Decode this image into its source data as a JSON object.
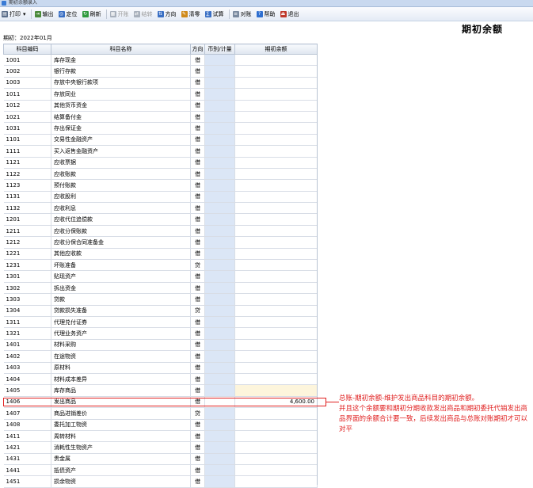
{
  "window": {
    "title": "期初余额录入"
  },
  "toolbar": [
    {
      "label": "打印",
      "icon": "printer-icon",
      "dropdown": true,
      "disabled": false,
      "color": "#5a6d8a"
    },
    {
      "label": "输出",
      "icon": "export-icon",
      "disabled": false,
      "color": "#4a8a3a"
    },
    {
      "label": "定位",
      "icon": "locate-icon",
      "disabled": false,
      "color": "#3a6fc4"
    },
    {
      "label": "刷新",
      "icon": "refresh-icon",
      "disabled": false,
      "color": "#2f9a3f"
    },
    {
      "label": "开账",
      "icon": "open-account-icon",
      "disabled": true,
      "color": "#a8b0bc"
    },
    {
      "label": "结转",
      "icon": "carry-over-icon",
      "disabled": true,
      "color": "#a8b0bc"
    },
    {
      "label": "方向",
      "icon": "direction-icon",
      "disabled": false,
      "color": "#3a6fc4"
    },
    {
      "label": "清零",
      "icon": "clear-icon",
      "disabled": false,
      "color": "#d08a1a"
    },
    {
      "label": "试算",
      "icon": "trial-balance-icon",
      "disabled": false,
      "color": "#3a6fc4"
    },
    {
      "label": "对账",
      "icon": "reconcile-icon",
      "disabled": false,
      "color": "#7a8aa0"
    },
    {
      "label": "帮助",
      "icon": "help-icon",
      "disabled": false,
      "color": "#2f6fd0"
    },
    {
      "label": "退出",
      "icon": "exit-icon",
      "disabled": false,
      "color": "#c0392b"
    }
  ],
  "page_title": "期初余额",
  "period_text": "期初：2022年01月",
  "columns": [
    "科目编码",
    "科目名称",
    "方向",
    "币别/计量",
    "期初余额"
  ],
  "rows": [
    {
      "code": "1001",
      "name": "库存现金",
      "dir": "借",
      "amount": ""
    },
    {
      "code": "1002",
      "name": "银行存款",
      "dir": "借",
      "amount": ""
    },
    {
      "code": "1003",
      "name": "存放中央银行款项",
      "dir": "借",
      "amount": ""
    },
    {
      "code": "1011",
      "name": "存放同业",
      "dir": "借",
      "amount": ""
    },
    {
      "code": "1012",
      "name": "其他货币资金",
      "dir": "借",
      "amount": ""
    },
    {
      "code": "1021",
      "name": "结算备付金",
      "dir": "借",
      "amount": ""
    },
    {
      "code": "1031",
      "name": "存出保证金",
      "dir": "借",
      "amount": ""
    },
    {
      "code": "1101",
      "name": "交易性金融资产",
      "dir": "借",
      "amount": ""
    },
    {
      "code": "1111",
      "name": "买入返售金融资产",
      "dir": "借",
      "amount": ""
    },
    {
      "code": "1121",
      "name": "应收票据",
      "dir": "借",
      "amount": ""
    },
    {
      "code": "1122",
      "name": "应收账款",
      "dir": "借",
      "amount": ""
    },
    {
      "code": "1123",
      "name": "预付账款",
      "dir": "借",
      "amount": ""
    },
    {
      "code": "1131",
      "name": "应收股利",
      "dir": "借",
      "amount": ""
    },
    {
      "code": "1132",
      "name": "应收利息",
      "dir": "借",
      "amount": ""
    },
    {
      "code": "1201",
      "name": "应收代位追偿款",
      "dir": "借",
      "amount": ""
    },
    {
      "code": "1211",
      "name": "应收分保账款",
      "dir": "借",
      "amount": ""
    },
    {
      "code": "1212",
      "name": "应收分保合同准备金",
      "dir": "借",
      "amount": ""
    },
    {
      "code": "1221",
      "name": "其他应收款",
      "dir": "借",
      "amount": ""
    },
    {
      "code": "1231",
      "name": "坏账准备",
      "dir": "贷",
      "amount": ""
    },
    {
      "code": "1301",
      "name": "贴现资产",
      "dir": "借",
      "amount": ""
    },
    {
      "code": "1302",
      "name": "拆出资金",
      "dir": "借",
      "amount": ""
    },
    {
      "code": "1303",
      "name": "贷款",
      "dir": "借",
      "amount": ""
    },
    {
      "code": "1304",
      "name": "贷款损失准备",
      "dir": "贷",
      "amount": ""
    },
    {
      "code": "1311",
      "name": "代理兑付证券",
      "dir": "借",
      "amount": ""
    },
    {
      "code": "1321",
      "name": "代理业务资产",
      "dir": "借",
      "amount": ""
    },
    {
      "code": "1401",
      "name": "材料采购",
      "dir": "借",
      "amount": ""
    },
    {
      "code": "1402",
      "name": "在途物资",
      "dir": "借",
      "amount": ""
    },
    {
      "code": "1403",
      "name": "原材料",
      "dir": "借",
      "amount": ""
    },
    {
      "code": "1404",
      "name": "材料成本差异",
      "dir": "借",
      "amount": ""
    },
    {
      "code": "1405",
      "name": "库存商品",
      "dir": "借",
      "amount": "",
      "highlight": true
    },
    {
      "code": "1406",
      "name": "发出商品",
      "dir": "借",
      "amount": "4,600.00",
      "selected": true
    },
    {
      "code": "1407",
      "name": "商品进销差价",
      "dir": "贷",
      "amount": ""
    },
    {
      "code": "1408",
      "name": "委托加工物资",
      "dir": "借",
      "amount": ""
    },
    {
      "code": "1411",
      "name": "周转材料",
      "dir": "借",
      "amount": ""
    },
    {
      "code": "1421",
      "name": "消耗性生物资产",
      "dir": "借",
      "amount": ""
    },
    {
      "code": "1431",
      "name": "贵金属",
      "dir": "借",
      "amount": ""
    },
    {
      "code": "1441",
      "name": "抵债资产",
      "dir": "借",
      "amount": ""
    },
    {
      "code": "1451",
      "name": "损余物资",
      "dir": "借",
      "amount": ""
    }
  ],
  "annotation": {
    "lines": [
      "总账-期初余额-维护发出商品科目的期初余额。",
      "并且这个余额要和期初分期收款发出商品和期初委托代销发出商品界面的余额合计要一致，后续发出商品与总账对账期初才可以对平"
    ],
    "color": "#e02020"
  }
}
